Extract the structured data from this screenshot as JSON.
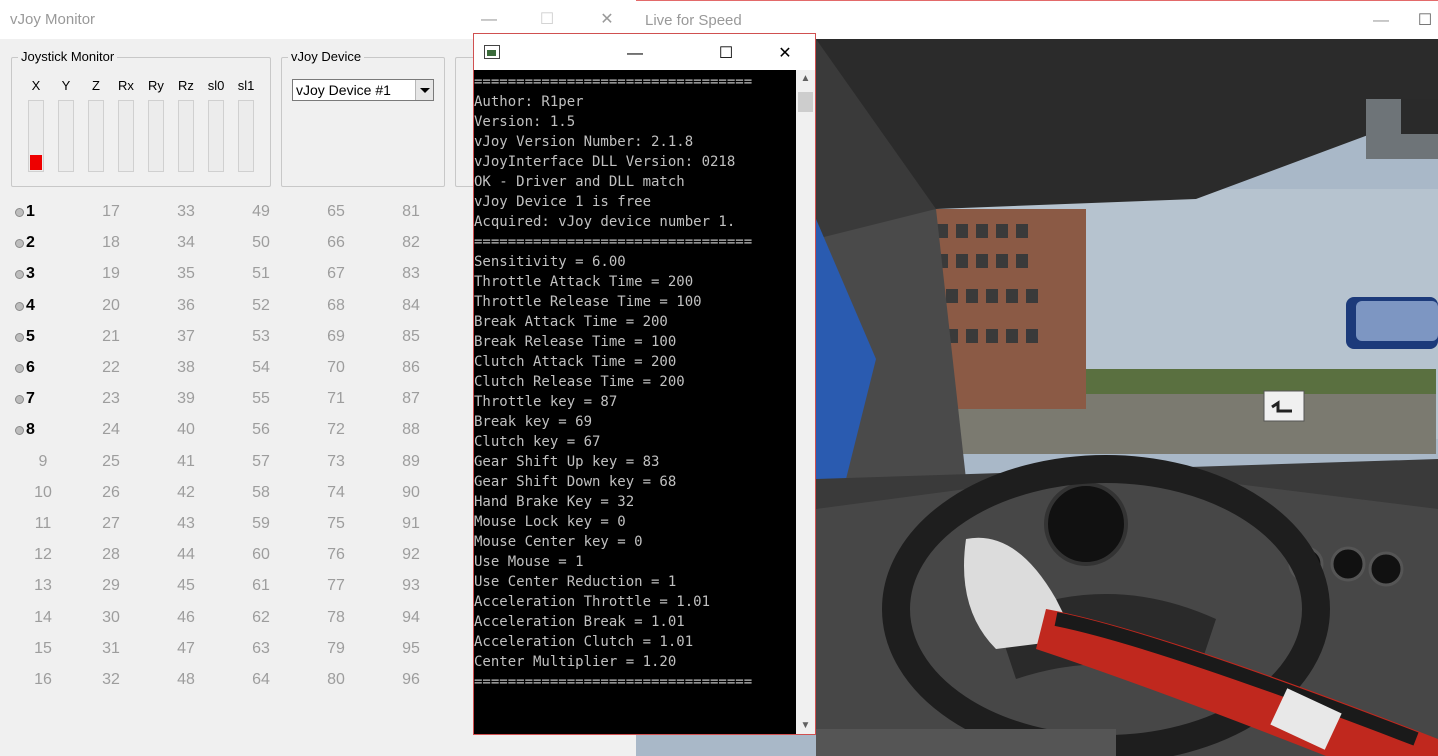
{
  "vjoy_monitor": {
    "title": "vJoy Monitor",
    "joystick_group": "Joystick Monitor",
    "axes": [
      {
        "label": "X",
        "level": 0.22
      },
      {
        "label": "Y",
        "level": 0
      },
      {
        "label": "Z",
        "level": 0
      },
      {
        "label": "Rx",
        "level": 0
      },
      {
        "label": "Ry",
        "level": 0
      },
      {
        "label": "Rz",
        "level": 0
      },
      {
        "label": "sl0",
        "level": 0
      },
      {
        "label": "sl1",
        "level": 0
      }
    ],
    "device_group": "vJoy Device",
    "device_selected": "vJoy Device #1",
    "buttons": {
      "columns": [
        [
          "1",
          "2",
          "3",
          "4",
          "5",
          "6",
          "7",
          "8",
          "9",
          "10",
          "11",
          "12",
          "13",
          "14",
          "15",
          "16"
        ],
        [
          "17",
          "18",
          "19",
          "20",
          "21",
          "22",
          "23",
          "24",
          "25",
          "26",
          "27",
          "28",
          "29",
          "30",
          "31",
          "32"
        ],
        [
          "33",
          "34",
          "35",
          "36",
          "37",
          "38",
          "39",
          "40",
          "41",
          "42",
          "43",
          "44",
          "45",
          "46",
          "47",
          "48"
        ],
        [
          "49",
          "50",
          "51",
          "52",
          "53",
          "54",
          "55",
          "56",
          "57",
          "58",
          "59",
          "60",
          "61",
          "62",
          "63",
          "64"
        ],
        [
          "65",
          "66",
          "67",
          "68",
          "69",
          "70",
          "71",
          "72",
          "73",
          "74",
          "75",
          "76",
          "77",
          "78",
          "79",
          "80"
        ],
        [
          "81",
          "82",
          "83",
          "84",
          "85",
          "86",
          "87",
          "88",
          "89",
          "90",
          "91",
          "92",
          "93",
          "94",
          "95",
          "96"
        ]
      ],
      "active_count": 8
    },
    "colors": {
      "axis_fill": "#ee0000"
    }
  },
  "lfs": {
    "title": "Live for Speed"
  },
  "console": {
    "lines": [
      "=================================",
      "Author: R1per",
      "Version: 1.5",
      "vJoy Version Number: 2.1.8",
      "vJoyInterface DLL Version: 0218",
      "OK - Driver and DLL match",
      "vJoy Device 1 is free",
      "Acquired: vJoy device number 1.",
      "=================================",
      "Sensitivity = 6.00",
      "Throttle Attack Time = 200",
      "Throttle Release Time = 100",
      "Break Attack Time = 200",
      "Break Release Time = 100",
      "Clutch Attack Time = 200",
      "Clutch Release Time = 200",
      "Throttle key = 87",
      "Break key = 69",
      "Clutch key = 67",
      "Gear Shift Up key = 83",
      "Gear Shift Down key = 68",
      "Hand Brake Key = 32",
      "Mouse Lock key = 0",
      "Mouse Center key = 0",
      "Use Mouse = 1",
      "Use Center Reduction = 1",
      "Acceleration Throttle = 1.01",
      "Acceleration Break = 1.01",
      "Acceleration Clutch = 1.01",
      "Center Multiplier = 1.20",
      "================================="
    ]
  },
  "window_controls": {
    "minimize": "—",
    "maximize": "☐",
    "close": "✕"
  }
}
